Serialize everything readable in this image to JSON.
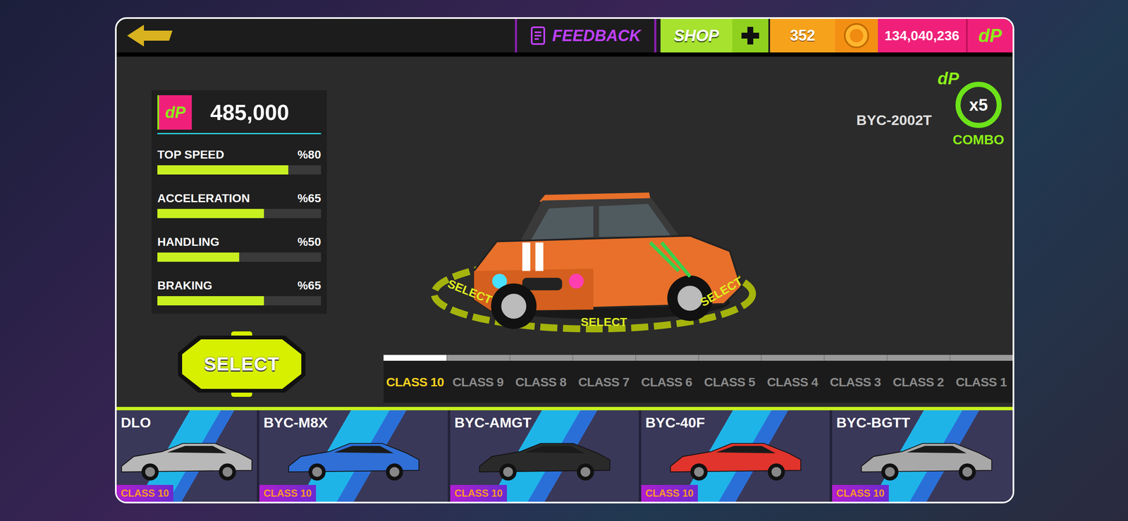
{
  "top_bar": {
    "feedback": "FEEDBACK",
    "shop": "SHOP",
    "gems": "352",
    "coins": "134,040,236",
    "currency_logo": "dP"
  },
  "car": {
    "name": "BYC-2002T",
    "price": "485,000"
  },
  "combo": {
    "multiplier": "x5",
    "label": "COMBO"
  },
  "stats": [
    {
      "label": "TOP SPEED",
      "reading": "%80",
      "level": 0.8
    },
    {
      "label": "ACCELERATION",
      "reading": "%65",
      "level": 0.65
    },
    {
      "label": "HANDLING",
      "reading": "%50",
      "level": 0.5
    },
    {
      "label": "BRAKING",
      "reading": "%65",
      "level": 0.65
    }
  ],
  "select_button": "SELECT",
  "ring_label": "SELECT",
  "classes": [
    {
      "label": "CLASS 10",
      "selected": true
    },
    {
      "label": "CLASS 9",
      "selected": false
    },
    {
      "label": "CLASS 8",
      "selected": false
    },
    {
      "label": "CLASS 7",
      "selected": false
    },
    {
      "label": "CLASS 6",
      "selected": false
    },
    {
      "label": "CLASS 5",
      "selected": false
    },
    {
      "label": "CLASS 4",
      "selected": false
    },
    {
      "label": "CLASS 3",
      "selected": false
    },
    {
      "label": "CLASS 2",
      "selected": false
    },
    {
      "label": "CLASS 1",
      "selected": false
    }
  ],
  "cars": [
    {
      "name": "DLO",
      "class": "CLASS 10",
      "color": "#b8b8b8"
    },
    {
      "name": "BYC-M8X",
      "class": "CLASS 10",
      "color": "#2f6fd6"
    },
    {
      "name": "BYC-AMGT",
      "class": "CLASS 10",
      "color": "#2a2a2a"
    },
    {
      "name": "BYC-40F",
      "class": "CLASS 10",
      "color": "#e0342c"
    },
    {
      "name": "BYC-BGTT",
      "class": "CLASS 10",
      "color": "#a8a8a8"
    }
  ]
}
